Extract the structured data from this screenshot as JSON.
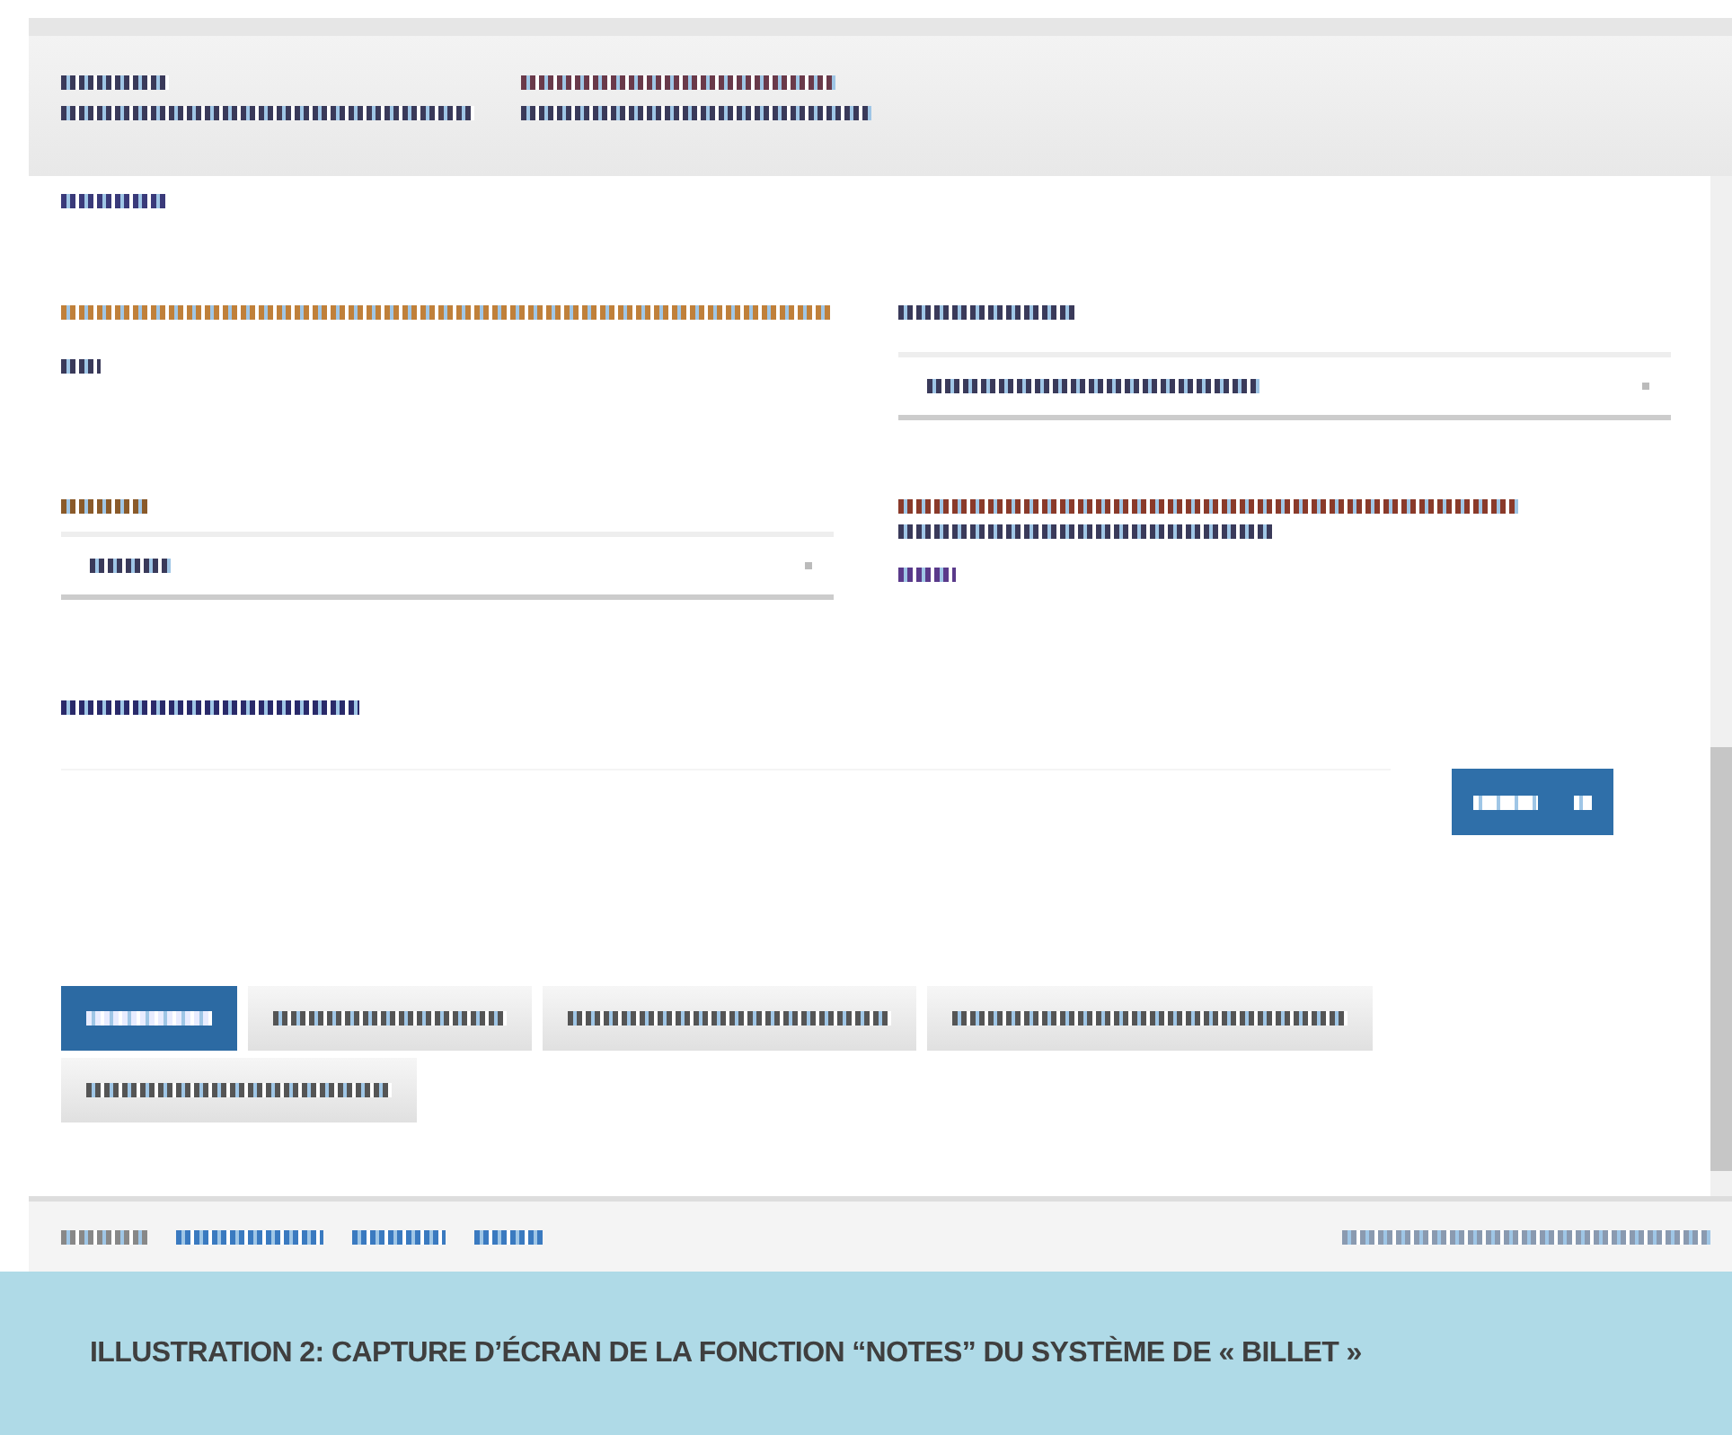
{
  "tabs": [
    {
      "selected": true
    },
    {
      "selected": false
    },
    {
      "selected": false
    },
    {
      "selected": false
    },
    {
      "selected": false
    }
  ],
  "caption": "ILLUSTRATION 2: CAPTURE D’ÉCRAN DE LA  FONCTION “NOTES” DU SYSTÈME DE « BILLET »"
}
